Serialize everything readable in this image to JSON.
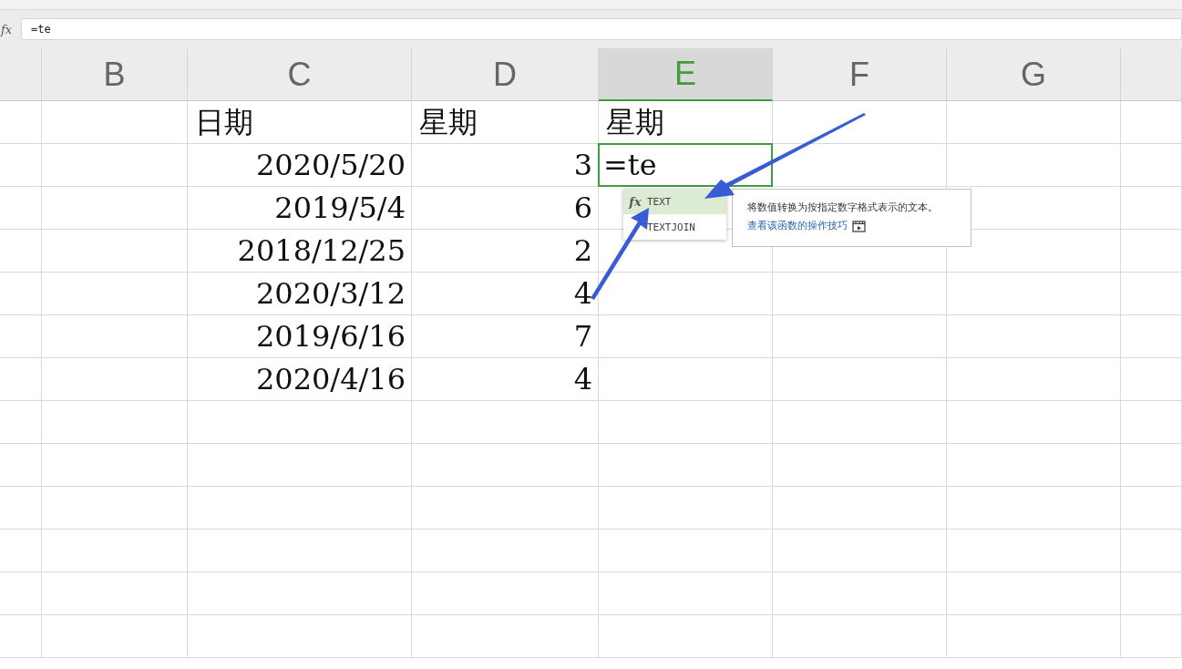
{
  "formula_bar": {
    "label": "fx",
    "value": "=te"
  },
  "columns": [
    {
      "label": "B",
      "selected": false
    },
    {
      "label": "C",
      "selected": false
    },
    {
      "label": "D",
      "selected": false
    },
    {
      "label": "E",
      "selected": true
    },
    {
      "label": "F",
      "selected": false
    },
    {
      "label": "G",
      "selected": false
    }
  ],
  "header_row": [
    "日期",
    "星期",
    "星期"
  ],
  "rows": [
    {
      "date": "2020/5/20",
      "weekday": "3"
    },
    {
      "date": "2019/5/4",
      "weekday": "6"
    },
    {
      "date": "2018/12/25",
      "weekday": "2"
    },
    {
      "date": "2020/3/12",
      "weekday": "4"
    },
    {
      "date": "2019/6/16",
      "weekday": "7"
    },
    {
      "date": "2020/4/16",
      "weekday": "4"
    }
  ],
  "active_cell": {
    "value": "=te"
  },
  "suggestions": [
    {
      "label": "TEXT",
      "selected": true,
      "icon": "fx"
    },
    {
      "label": "TEXTJOIN",
      "selected": false
    }
  ],
  "tooltip": {
    "description": "将数值转换为按指定数字格式表示的文本。",
    "link": "查看该函数的操作技巧"
  }
}
